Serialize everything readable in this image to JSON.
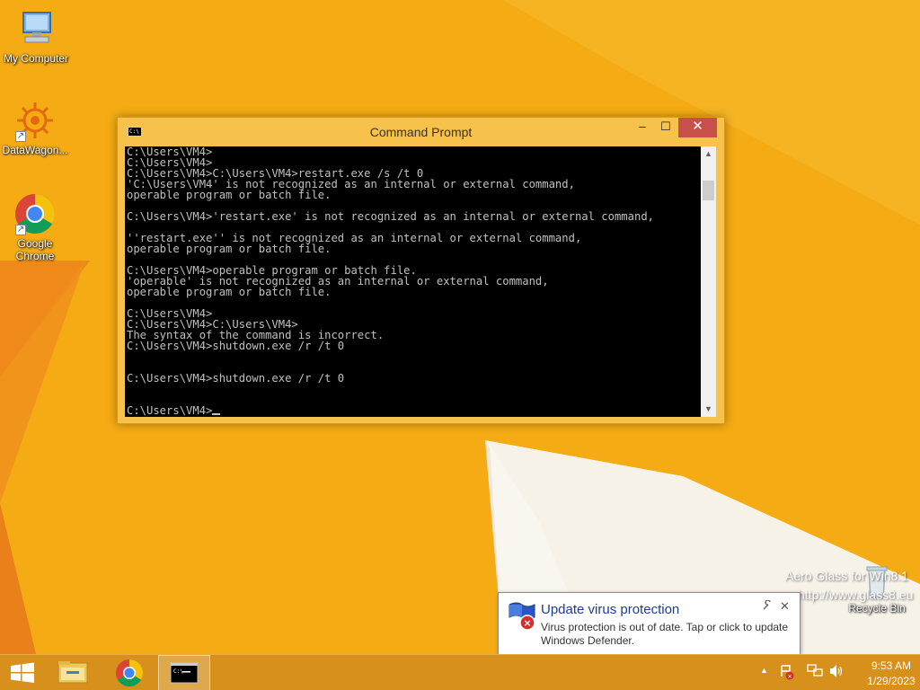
{
  "desktop": {
    "icons": [
      {
        "label": "My Computer",
        "icon": "computer-icon"
      },
      {
        "label": "DataWagon...",
        "icon": "datawagon-icon"
      },
      {
        "label": "Google Chrome",
        "icon": "chrome-icon"
      },
      {
        "label": "Recycle Bin",
        "icon": "recycle-bin-icon"
      }
    ],
    "watermark": {
      "line1": "Aero Glass for Win8.1",
      "line2": "http://www.glass8.eu"
    }
  },
  "cmd_window": {
    "title": "Command Prompt",
    "title_icon_text": "C:\\",
    "buttons": {
      "minimize": "–",
      "maximize": "☐",
      "close": "✕"
    },
    "lines": [
      "C:\\Users\\VM4>",
      "C:\\Users\\VM4>",
      "C:\\Users\\VM4>C:\\Users\\VM4>restart.exe /s /t 0",
      "'C:\\Users\\VM4' is not recognized as an internal or external command,",
      "operable program or batch file.",
      "",
      "C:\\Users\\VM4>'restart.exe' is not recognized as an internal or external command,",
      "",
      "''restart.exe'' is not recognized as an internal or external command,",
      "operable program or batch file.",
      "",
      "C:\\Users\\VM4>operable program or batch file.",
      "'operable' is not recognized as an internal or external command,",
      "operable program or batch file.",
      "",
      "C:\\Users\\VM4>",
      "C:\\Users\\VM4>C:\\Users\\VM4>",
      "The syntax of the command is incorrect.",
      "C:\\Users\\VM4>shutdown.exe /r /t 0",
      "",
      "",
      "C:\\Users\\VM4>shutdown.exe /r /t 0",
      "",
      "",
      "C:\\Users\\VM4>"
    ]
  },
  "notification": {
    "title": "Update virus protection",
    "message": "Virus protection is out of date. Tap or click to update Windows Defender.",
    "close": "✕",
    "settings_icon": "wrench-icon",
    "icon": "defender-warning-icon"
  },
  "taskbar": {
    "start_icon": "windows-logo-icon",
    "pinned": [
      "file-explorer-icon",
      "chrome-icon",
      "command-prompt-icon"
    ],
    "tray": {
      "chevron": "▲",
      "time": "9:53 AM",
      "date": "1/29/2023"
    }
  },
  "colors": {
    "wallpaper": "#f2a813",
    "close_button": "#c7504a",
    "notification_title": "#1c3b9b"
  }
}
